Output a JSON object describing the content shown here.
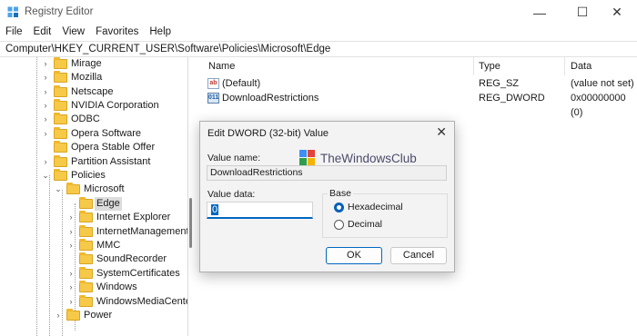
{
  "window": {
    "title": "Registry Editor",
    "controls": {
      "minimize": "—",
      "maximize": "☐",
      "close": "✕"
    }
  },
  "menu": [
    "File",
    "Edit",
    "View",
    "Favorites",
    "Help"
  ],
  "address": "Computer\\HKEY_CURRENT_USER\\Software\\Policies\\Microsoft\\Edge",
  "tree": {
    "items": [
      {
        "label": "Mirage",
        "expander": "›"
      },
      {
        "label": "Mozilla",
        "expander": "›"
      },
      {
        "label": "Netscape",
        "expander": "›"
      },
      {
        "label": "NVIDIA Corporation",
        "expander": "›"
      },
      {
        "label": "ODBC",
        "expander": "›"
      },
      {
        "label": "Opera Software",
        "expander": "›"
      },
      {
        "label": "Opera Stable Offer",
        "expander": ""
      },
      {
        "label": "Partition Assistant",
        "expander": "›"
      },
      {
        "label": "Policies",
        "expander": "⌄"
      },
      {
        "label": "Microsoft",
        "expander": "⌄"
      },
      {
        "label": "Edge",
        "expander": "",
        "selected": true
      },
      {
        "label": "Internet Explorer",
        "expander": "›"
      },
      {
        "label": "InternetManagement",
        "expander": "›"
      },
      {
        "label": "MMC",
        "expander": "›"
      },
      {
        "label": "SoundRecorder",
        "expander": ""
      },
      {
        "label": "SystemCertificates",
        "expander": "›"
      },
      {
        "label": "Windows",
        "expander": "›"
      },
      {
        "label": "WindowsMediaCente",
        "expander": "›"
      },
      {
        "label": "Power",
        "expander": "›"
      }
    ]
  },
  "list": {
    "columns": [
      "Name",
      "Type",
      "Data"
    ],
    "rows": [
      {
        "icon": "ab",
        "name": "(Default)",
        "type": "REG_SZ",
        "data": "(value not set)"
      },
      {
        "icon": "011",
        "name": "DownloadRestrictions",
        "type": "REG_DWORD",
        "data": "0x00000000 (0)"
      }
    ]
  },
  "dialog": {
    "title": "Edit DWORD (32-bit) Value",
    "close": "✕",
    "value_name_label": "Value name:",
    "value_name": "DownloadRestrictions",
    "value_data_label": "Value data:",
    "value_data": "0",
    "base_label": "Base",
    "base_options": [
      "Hexadecimal",
      "Decimal"
    ],
    "base_selected": "Hexadecimal",
    "ok_label": "OK",
    "cancel_label": "Cancel"
  },
  "watermark": "TheWindowsClub",
  "colors": {
    "accent": "#0067c0",
    "folder": "#f7c948",
    "watermark_logo": [
      "#3d8ef5",
      "#e2433b",
      "#2d9e4a",
      "#f4b400"
    ]
  }
}
